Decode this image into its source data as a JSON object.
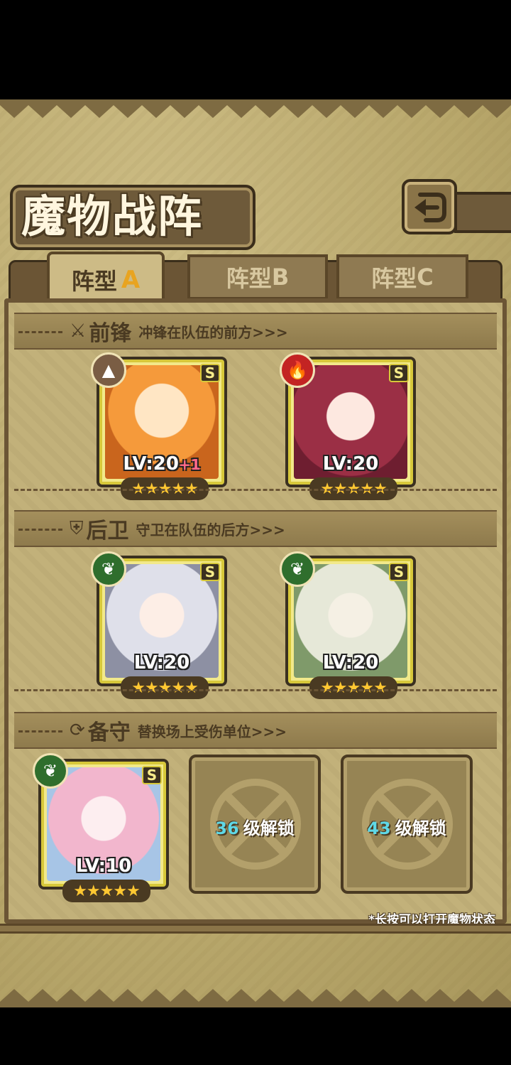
{
  "title": "魔物战阵",
  "tabs": [
    {
      "label": "阵型",
      "letter": "A"
    },
    {
      "label": "阵型",
      "letter": "B"
    },
    {
      "label": "阵型",
      "letter": "C"
    }
  ],
  "sections": {
    "front": {
      "name": "前锋",
      "desc": "冲锋在队伍的前方>>>",
      "icon": "sword-icon"
    },
    "rear": {
      "name": "后卫",
      "desc": "守卫在队伍的后方>>>",
      "icon": "shield-icon"
    },
    "reserve": {
      "name": "备守",
      "desc": "替换场上受伤单位>>>",
      "icon": "swap-icon"
    }
  },
  "front_cards": [
    {
      "element": "rock",
      "rank": "S",
      "level": "LV:20",
      "bonus": "+1",
      "stars": "★★★★★"
    },
    {
      "element": "fire",
      "rank": "S",
      "level": "LV:20",
      "bonus": "",
      "stars": "★★★★★"
    }
  ],
  "rear_cards": [
    {
      "element": "leaf",
      "rank": "S",
      "level": "LV:20",
      "stars": "★★★★★"
    },
    {
      "element": "leaf",
      "rank": "S",
      "level": "LV:20",
      "stars": "★★★★★"
    }
  ],
  "reserve_card": {
    "element": "leaf",
    "rank": "S",
    "level": "LV:10",
    "stars": "★★★★★"
  },
  "locked_slots": [
    {
      "level": "36",
      "text": "级解锁"
    },
    {
      "level": "43",
      "text": "级解锁"
    }
  ],
  "hint": "*长按可以打开魔物状态",
  "colors": {
    "accent_star": "#ffc832",
    "card_frame": "#d7c83a",
    "unlock_level": "#5fd8e6"
  }
}
